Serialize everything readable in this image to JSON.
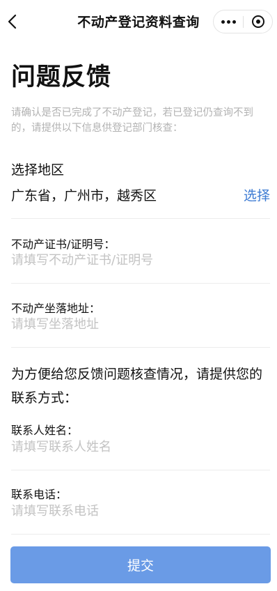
{
  "navbar": {
    "title": "不动产登记资料查询",
    "back_icon": "chevron-left-icon",
    "more_icon": "more-dots-icon",
    "close_icon": "target-circle-icon"
  },
  "page": {
    "title": "问题反馈",
    "intro": "请确认是否已完成了不动产登记，若已登记仍查询不到的，请提供以下信息供登记部门核查："
  },
  "region": {
    "label": "选择地区",
    "value": "广东省，广州市，越秀区",
    "select_label": "选择"
  },
  "fields": {
    "certificate": {
      "label": "不动产证书/证明号：",
      "placeholder": "请填写不动产证书/证明号"
    },
    "address": {
      "label": "不动产坐落地址：",
      "placeholder": "请填写坐落地址"
    },
    "contact_name": {
      "label": "联系人姓名：",
      "placeholder": "请填写联系人姓名"
    },
    "contact_phone": {
      "label": "联系电话：",
      "placeholder": "请填写联系电话"
    }
  },
  "contact": {
    "heading": "为方便给您反馈问题核查情况，请提供您的联系方式："
  },
  "submit": {
    "label": "提交"
  },
  "colors": {
    "accent": "#3d7bd3",
    "button": "#6a9be6",
    "placeholder": "#c3c3c3",
    "hint": "#b2b2b2"
  }
}
